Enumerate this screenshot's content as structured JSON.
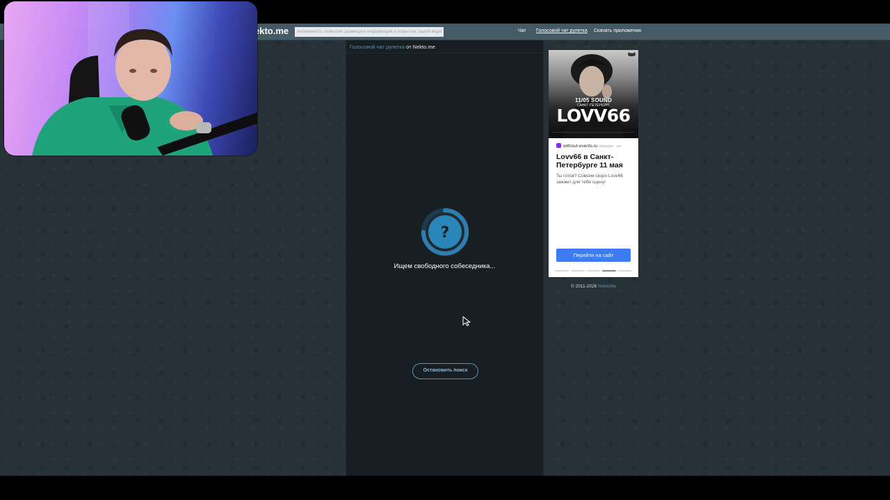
{
  "site": {
    "logo": "ekto.me",
    "tagline": "Анонимность позволяет размещать информацию в открытом, сырой вида!"
  },
  "nav": {
    "items": [
      "Чат",
      "Голосовой чат рулетка",
      "Скачать приложения"
    ]
  },
  "chat": {
    "header_link": "Голосовой чат рулетка",
    "header_from": "от",
    "header_brand": "Nekto.me",
    "status": "Ищем свободного собеседника...",
    "spinner_glyph": "?",
    "stop_button": "Остановить поиск"
  },
  "ad": {
    "menu_glyph": "•••",
    "event_date": "11/05 SOUND",
    "event_city": "САНКТ-ПЕТЕРБУРГ",
    "artist": "LOVV66",
    "source": "without-events.ru",
    "source_meta": "РЕКЛАМА · 18+",
    "title": "Lovv66 в Санкт-Петербурге 11 мая",
    "text": "Ты готов? Совсем скоро Lovv66 зажжет для тебя сцену!",
    "cta": "Перейти на сайт",
    "slides": 5,
    "active_slide": 4
  },
  "footer": {
    "copyright": "© 2011-2026",
    "brand": "NektoMe"
  },
  "colors": {
    "accent": "#5b8db2",
    "cta": "#3d7cf5",
    "background": "#263238",
    "panel": "#181f23"
  }
}
